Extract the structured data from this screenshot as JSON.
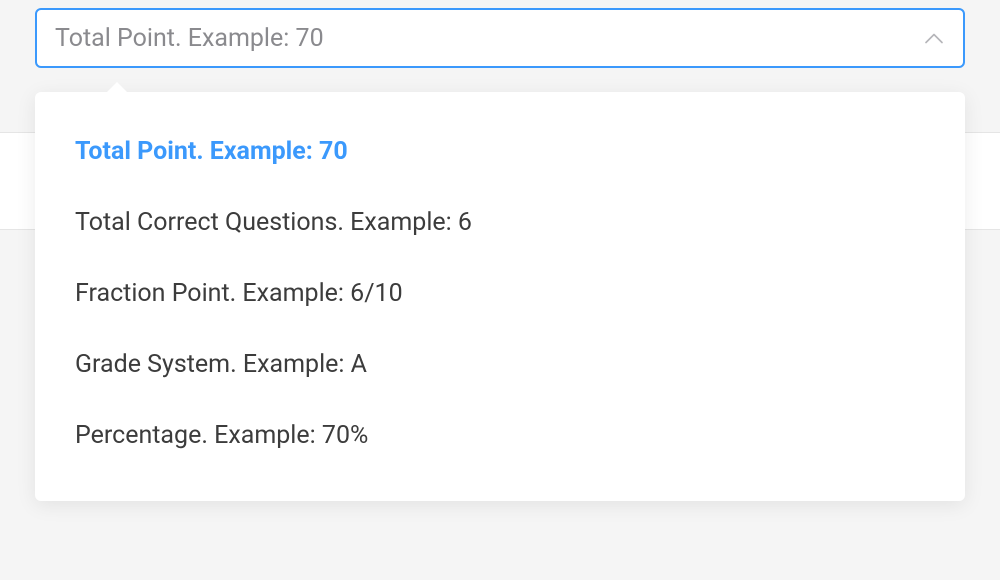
{
  "select": {
    "selected_value": "Total Point. Example: 70",
    "options": [
      {
        "label": "Total Point. Example: 70",
        "selected": true
      },
      {
        "label": "Total Correct Questions. Example: 6",
        "selected": false
      },
      {
        "label": "Fraction Point. Example: 6/10",
        "selected": false
      },
      {
        "label": "Grade System. Example: A",
        "selected": false
      },
      {
        "label": "Percentage. Example: 70%",
        "selected": false
      }
    ]
  },
  "colors": {
    "accent": "#3b99fc",
    "text_muted": "#8a8a8e",
    "text_primary": "#3c3c3c"
  }
}
